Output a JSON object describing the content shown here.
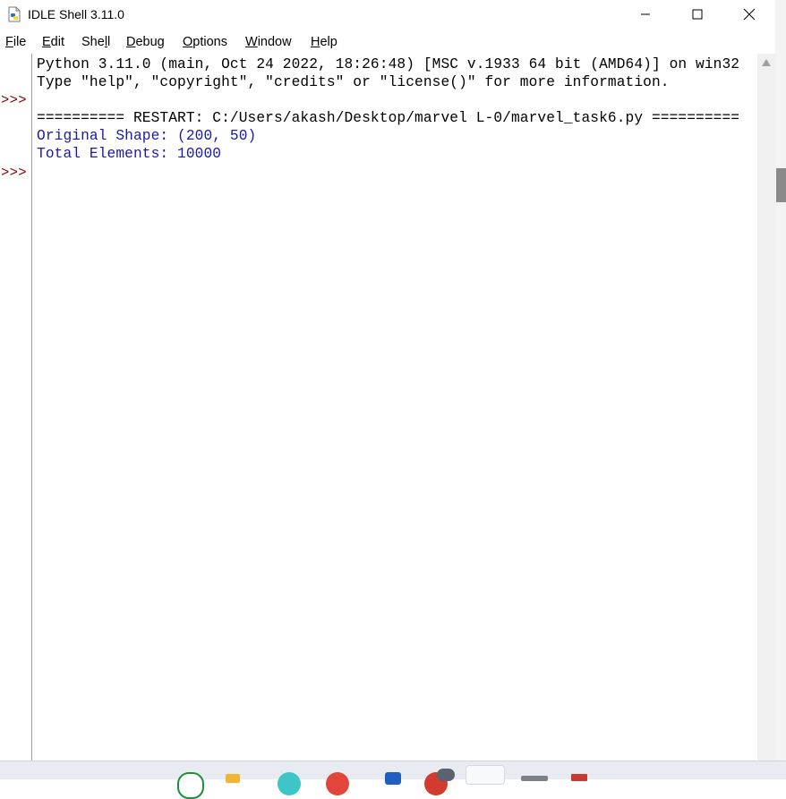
{
  "window": {
    "title": "IDLE Shell 3.11.0",
    "icon": "python-file-icon"
  },
  "menu": [
    {
      "label": "File",
      "mnemonic": "F",
      "rest": "ile"
    },
    {
      "label": "Edit",
      "mnemonic": "E",
      "rest": "dit"
    },
    {
      "label": "Shell",
      "pre": "She",
      "mnemonic": "l",
      "rest": "l"
    },
    {
      "label": "Debug",
      "mnemonic": "D",
      "rest": "ebug"
    },
    {
      "label": "Options",
      "mnemonic": "O",
      "rest": "ptions"
    },
    {
      "label": "Window",
      "mnemonic": "W",
      "rest": "indow"
    },
    {
      "label": "Help",
      "mnemonic": "H",
      "rest": "elp"
    }
  ],
  "shell": {
    "prompt": ">>>",
    "lines": [
      "Python 3.11.0 (main, Oct 24 2022, 18:26:48) [MSC v.1933 64 bit (AMD64)] on win32",
      "Type \"help\", \"copyright\", \"credits\" or \"license()\" for more information.",
      "========== RESTART: C:/Users/akash/Desktop/marvel L-0/marvel_task6.py ==========",
      "Original Shape: (200, 50)",
      "Total Elements: 10000"
    ]
  },
  "colors": {
    "output_blue": "#1a1aa6",
    "prompt_red": "#8b0000"
  }
}
